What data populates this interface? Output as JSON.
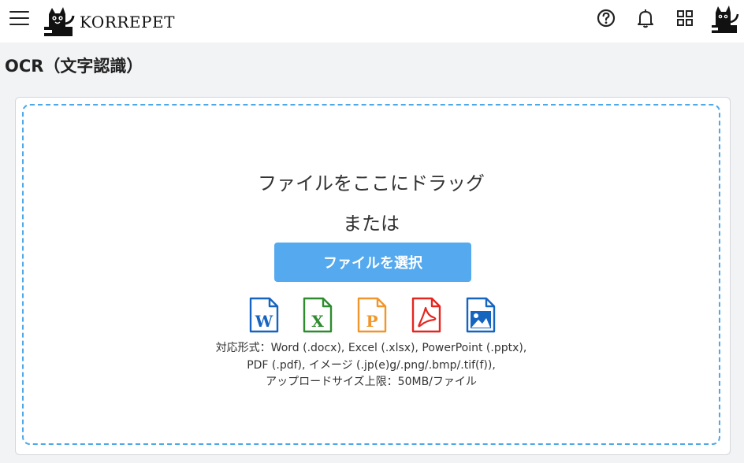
{
  "header": {
    "brand": "KORREPET",
    "icons": [
      "menu-icon",
      "help-icon",
      "bell-icon",
      "apps-grid-icon",
      "avatar-cat"
    ]
  },
  "page": {
    "title": "OCR（文字認識）"
  },
  "upload": {
    "drag_text": "ファイルをここにドラッグ",
    "or_text": "または",
    "select_button": "ファイルを選択",
    "file_types": [
      {
        "name": "word",
        "letter": "W",
        "color": "#1565c0"
      },
      {
        "name": "excel",
        "letter": "X",
        "color": "#2e8b2e"
      },
      {
        "name": "powerpoint",
        "letter": "P",
        "color": "#f0962a"
      },
      {
        "name": "pdf",
        "letter": "",
        "color": "#e52620"
      },
      {
        "name": "image",
        "letter": "",
        "color": "#1565c0"
      }
    ],
    "formats_line1": "対応形式：Word (.docx), Excel (.xlsx), PowerPoint (.pptx),",
    "formats_line2": "PDF (.pdf), イメージ (.jp(e)g/.png/.bmp/.tif(f)),",
    "formats_line3": "アップロードサイズ上限：50MB/ファイル"
  },
  "colors": {
    "accent": "#55a9ee",
    "dash": "#4da8e8",
    "background": "#f2f3f5"
  }
}
